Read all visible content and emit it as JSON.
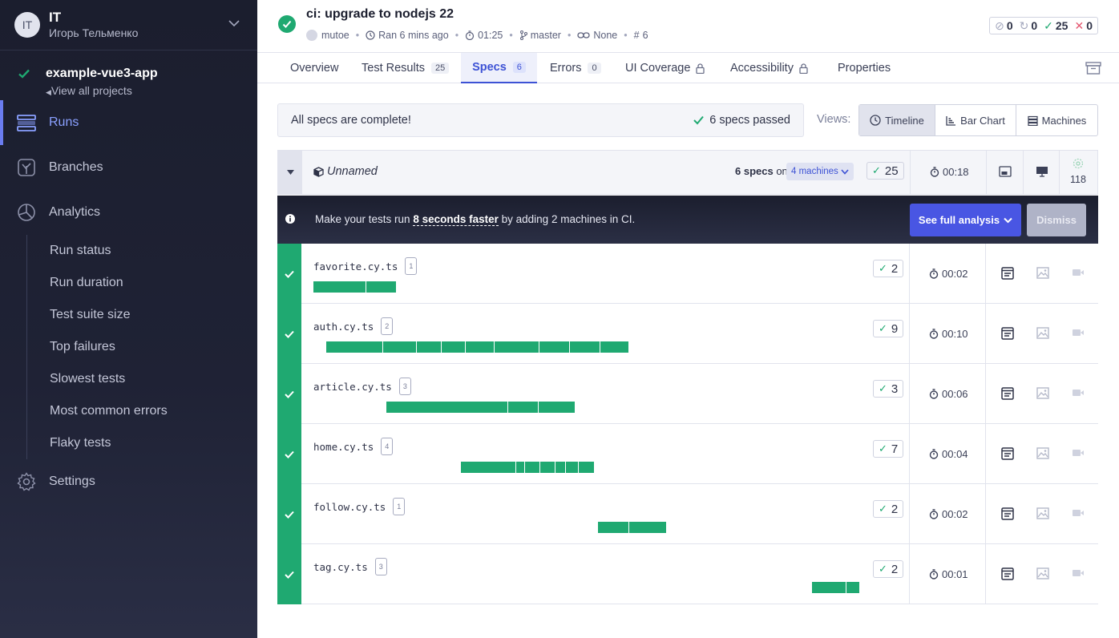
{
  "org": {
    "initials": "IT",
    "name": "IT",
    "user": "Игорь Тельменко"
  },
  "project": {
    "name": "example-vue3-app",
    "view_all": "View all projects"
  },
  "nav": {
    "runs": "Runs",
    "branches": "Branches",
    "analytics": "Analytics",
    "analytics_items": [
      "Run status",
      "Run duration",
      "Test suite size",
      "Top failures",
      "Slowest tests",
      "Most common errors",
      "Flaky tests"
    ],
    "settings": "Settings"
  },
  "run": {
    "title": "ci: upgrade to nodejs 22",
    "author": "mutoe",
    "ran": "Ran 6 mins ago",
    "duration": "01:25",
    "branch": "master",
    "link": "None",
    "number": "6",
    "counts": {
      "skipped": "0",
      "pending": "0",
      "passed": "25",
      "failed": "0"
    }
  },
  "tabs": [
    {
      "label": "Overview",
      "badge": ""
    },
    {
      "label": "Test Results",
      "badge": "25"
    },
    {
      "label": "Specs",
      "badge": "6"
    },
    {
      "label": "Errors",
      "badge": "0"
    },
    {
      "label": "UI Coverage",
      "badge": ""
    },
    {
      "label": "Accessibility",
      "badge": ""
    },
    {
      "label": "Properties",
      "badge": ""
    }
  ],
  "banner": {
    "text": "All specs are complete!",
    "passed": "6 specs passed"
  },
  "views": {
    "label": "Views:",
    "timeline": "Timeline",
    "bar_chart": "Bar Chart",
    "machines": "Machines"
  },
  "group": {
    "name": "Unnamed",
    "specs": "6 specs",
    "on": "on",
    "machines": "4 machines",
    "passed": "25",
    "duration": "00:18",
    "flake_count": "118"
  },
  "promo": {
    "prefix": "Make your tests run",
    "highlight": "8 seconds faster",
    "suffix": "by adding 2 machines in CI.",
    "cta": "See full analysis",
    "dismiss": "Dismiss"
  },
  "specs": [
    {
      "name": "favorite.cy.ts",
      "machine": "1",
      "passed": "2",
      "duration": "00:02"
    },
    {
      "name": "auth.cy.ts",
      "machine": "2",
      "passed": "9",
      "duration": "00:10"
    },
    {
      "name": "article.cy.ts",
      "machine": "3",
      "passed": "3",
      "duration": "00:06"
    },
    {
      "name": "home.cy.ts",
      "machine": "4",
      "passed": "7",
      "duration": "00:04"
    },
    {
      "name": "follow.cy.ts",
      "machine": "1",
      "passed": "2",
      "duration": "00:02"
    },
    {
      "name": "tag.cy.ts",
      "machine": "3",
      "passed": "2",
      "duration": "00:01"
    }
  ],
  "colors": {
    "pass": "#1fa971",
    "accent": "#3d52d5",
    "sidebar": "#1b1e2e"
  }
}
